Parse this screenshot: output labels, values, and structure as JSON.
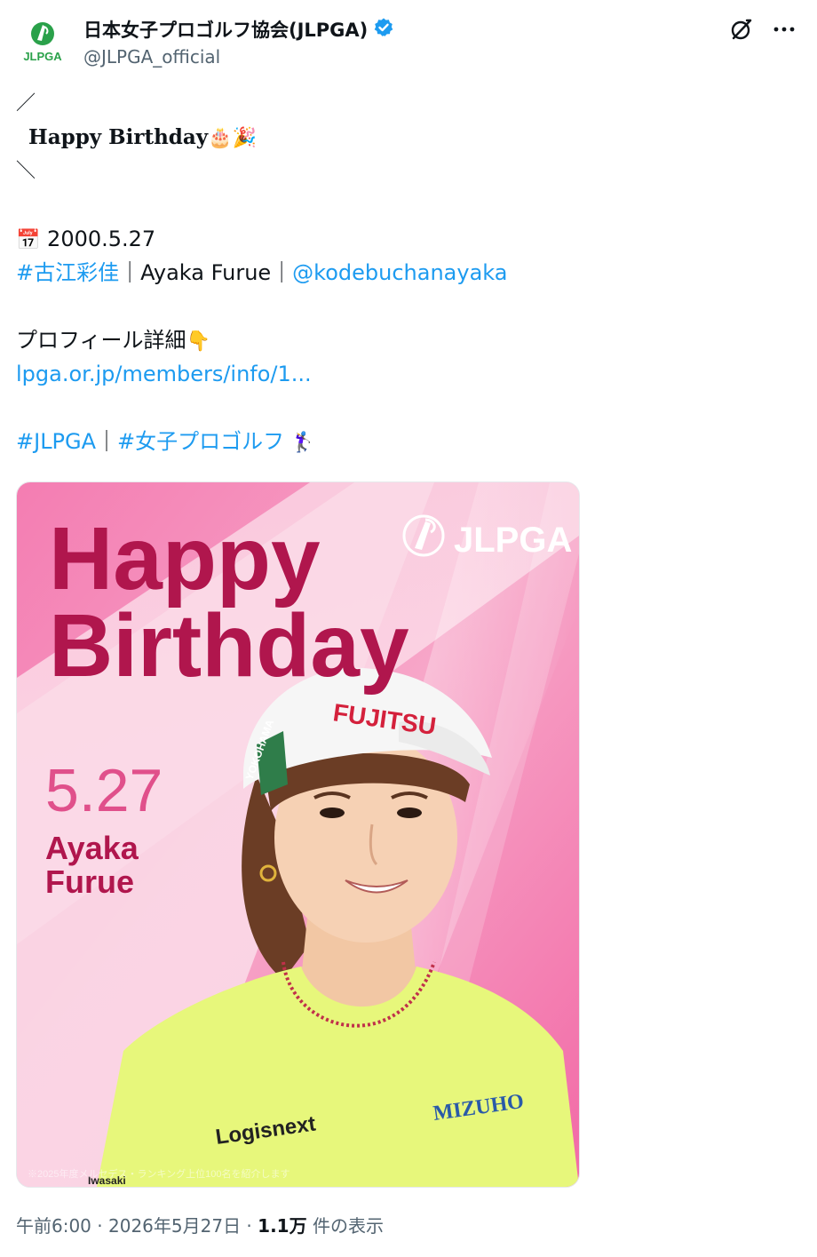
{
  "author": {
    "name": "日本女子プロゴルフ協会(JLPGA)",
    "handle": "@JLPGA_official",
    "verified_color": "#1d9bf0",
    "avatar_text": "JLPGA",
    "avatar_color": "#2aa14a"
  },
  "tweet": {
    "slash_open": "／",
    "headline": "Happy Birthday",
    "headline_emoji": "🎂🎉",
    "slash_close": "＼",
    "date_emoji": "📅",
    "date": "2000.5.27",
    "hashtag_name": "#古江彩佳",
    "separator1": "｜Ayaka Furue｜",
    "mention": "@kodebuchanayaka",
    "profile_label": "プロフィール詳細",
    "profile_emoji": "👇",
    "profile_link": "lpga.or.jp/members/info/1...",
    "hashtag_jlpga": "#JLPGA",
    "separator2": "｜",
    "hashtag_golf": "#女子プロゴルフ",
    "golf_emoji": "🏌️‍♀️"
  },
  "media": {
    "title_line1": "Happy",
    "title_line2": "Birthday",
    "date": "5.27",
    "player_first": "Ayaka",
    "player_last": "Furue",
    "logo_text": "JLPGA",
    "cap_sponsor": "FUJITSU",
    "cap_side": "YOKOHAMA",
    "shirt_sponsor_left": "Logisnext",
    "shirt_sponsor_right": "MIZUHO",
    "footnote": "※2025年度メルセデス・ランキング上位100名を紹介します",
    "sleeve_text": "Iwasaki",
    "colors": {
      "title": "#b0164d",
      "date": "#e0508b",
      "bg_pink": "#f56fae",
      "shirt": "#e6f57a"
    }
  },
  "meta": {
    "time": "午前6:00",
    "dot1": " · ",
    "date": "2026年5月27日",
    "dot2": " · ",
    "views": "1.1万",
    "views_suffix": " 件の表示"
  }
}
